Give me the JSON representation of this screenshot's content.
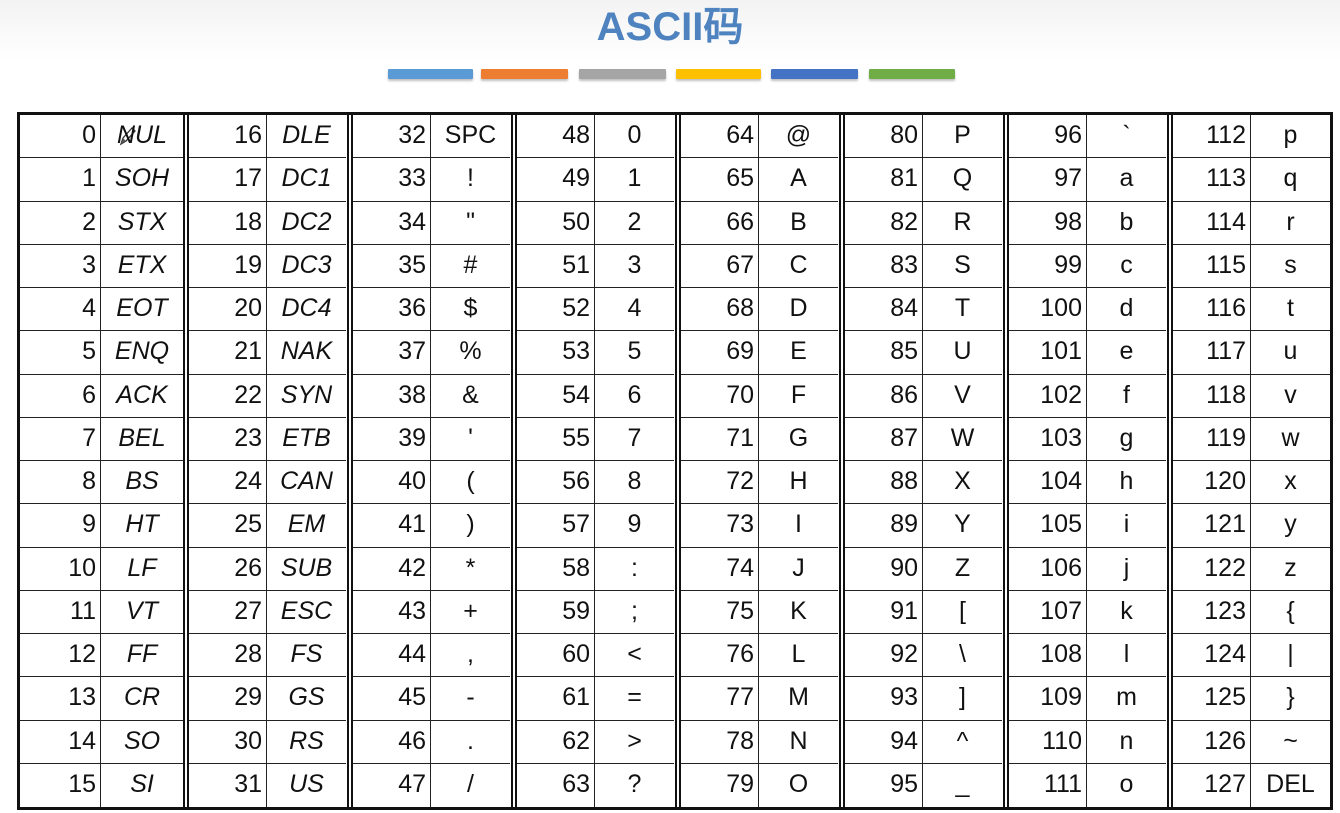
{
  "title": "ASCII码",
  "watermark": "",
  "accent_bars": [
    "#5b9bd5",
    "#ed7d31",
    "#a5a5a5",
    "#ffc000",
    "#4472c4",
    "#70ad47"
  ],
  "table": {
    "groups": [
      {
        "rows": [
          [
            "0",
            "NUL"
          ],
          [
            "1",
            "SOH"
          ],
          [
            "2",
            "STX"
          ],
          [
            "3",
            "ETX"
          ],
          [
            "4",
            "EOT"
          ],
          [
            "5",
            "ENQ"
          ],
          [
            "6",
            "ACK"
          ],
          [
            "7",
            "BEL"
          ],
          [
            "8",
            "BS"
          ],
          [
            "9",
            "HT"
          ],
          [
            "10",
            "LF"
          ],
          [
            "11",
            "VT"
          ],
          [
            "12",
            "FF"
          ],
          [
            "13",
            "CR"
          ],
          [
            "14",
            "SO"
          ],
          [
            "15",
            "SI"
          ]
        ],
        "italic": true
      },
      {
        "rows": [
          [
            "16",
            "DLE"
          ],
          [
            "17",
            "DC1"
          ],
          [
            "18",
            "DC2"
          ],
          [
            "19",
            "DC3"
          ],
          [
            "20",
            "DC4"
          ],
          [
            "21",
            "NAK"
          ],
          [
            "22",
            "SYN"
          ],
          [
            "23",
            "ETB"
          ],
          [
            "24",
            "CAN"
          ],
          [
            "25",
            "EM"
          ],
          [
            "26",
            "SUB"
          ],
          [
            "27",
            "ESC"
          ],
          [
            "28",
            "FS"
          ],
          [
            "29",
            "GS"
          ],
          [
            "30",
            "RS"
          ],
          [
            "31",
            "US"
          ]
        ],
        "italic": true
      },
      {
        "rows": [
          [
            "32",
            "SPC"
          ],
          [
            "33",
            "!"
          ],
          [
            "34",
            "\""
          ],
          [
            "35",
            "#"
          ],
          [
            "36",
            "$"
          ],
          [
            "37",
            "%"
          ],
          [
            "38",
            "&"
          ],
          [
            "39",
            "'"
          ],
          [
            "40",
            "("
          ],
          [
            "41",
            ")"
          ],
          [
            "42",
            "*"
          ],
          [
            "43",
            "+"
          ],
          [
            "44",
            ","
          ],
          [
            "45",
            "-"
          ],
          [
            "46",
            "."
          ],
          [
            "47",
            "/"
          ]
        ],
        "italic": false
      },
      {
        "rows": [
          [
            "48",
            "0"
          ],
          [
            "49",
            "1"
          ],
          [
            "50",
            "2"
          ],
          [
            "51",
            "3"
          ],
          [
            "52",
            "4"
          ],
          [
            "53",
            "5"
          ],
          [
            "54",
            "6"
          ],
          [
            "55",
            "7"
          ],
          [
            "56",
            "8"
          ],
          [
            "57",
            "9"
          ],
          [
            "58",
            ":"
          ],
          [
            "59",
            ";"
          ],
          [
            "60",
            "<"
          ],
          [
            "61",
            "="
          ],
          [
            "62",
            ">"
          ],
          [
            "63",
            "?"
          ]
        ],
        "italic": false
      },
      {
        "rows": [
          [
            "64",
            "@"
          ],
          [
            "65",
            "A"
          ],
          [
            "66",
            "B"
          ],
          [
            "67",
            "C"
          ],
          [
            "68",
            "D"
          ],
          [
            "69",
            "E"
          ],
          [
            "70",
            "F"
          ],
          [
            "71",
            "G"
          ],
          [
            "72",
            "H"
          ],
          [
            "73",
            "I"
          ],
          [
            "74",
            "J"
          ],
          [
            "75",
            "K"
          ],
          [
            "76",
            "L"
          ],
          [
            "77",
            "M"
          ],
          [
            "78",
            "N"
          ],
          [
            "79",
            "O"
          ]
        ],
        "italic": false
      },
      {
        "rows": [
          [
            "80",
            "P"
          ],
          [
            "81",
            "Q"
          ],
          [
            "82",
            "R"
          ],
          [
            "83",
            "S"
          ],
          [
            "84",
            "T"
          ],
          [
            "85",
            "U"
          ],
          [
            "86",
            "V"
          ],
          [
            "87",
            "W"
          ],
          [
            "88",
            "X"
          ],
          [
            "89",
            "Y"
          ],
          [
            "90",
            "Z"
          ],
          [
            "91",
            "["
          ],
          [
            "92",
            "\\"
          ],
          [
            "93",
            "]"
          ],
          [
            "94",
            "^"
          ],
          [
            "95",
            "_"
          ]
        ],
        "italic": false
      },
      {
        "rows": [
          [
            "96",
            "`"
          ],
          [
            "97",
            "a"
          ],
          [
            "98",
            "b"
          ],
          [
            "99",
            "c"
          ],
          [
            "100",
            "d"
          ],
          [
            "101",
            "e"
          ],
          [
            "102",
            "f"
          ],
          [
            "103",
            "g"
          ],
          [
            "104",
            "h"
          ],
          [
            "105",
            "i"
          ],
          [
            "106",
            "j"
          ],
          [
            "107",
            "k"
          ],
          [
            "108",
            "l"
          ],
          [
            "109",
            "m"
          ],
          [
            "110",
            "n"
          ],
          [
            "111",
            "o"
          ]
        ],
        "italic": false
      },
      {
        "rows": [
          [
            "112",
            "p"
          ],
          [
            "113",
            "q"
          ],
          [
            "114",
            "r"
          ],
          [
            "115",
            "s"
          ],
          [
            "116",
            "t"
          ],
          [
            "117",
            "u"
          ],
          [
            "118",
            "v"
          ],
          [
            "119",
            "w"
          ],
          [
            "120",
            "x"
          ],
          [
            "121",
            "y"
          ],
          [
            "122",
            "z"
          ],
          [
            "123",
            "{"
          ],
          [
            "124",
            "|"
          ],
          [
            "125",
            "}"
          ],
          [
            "126",
            "~"
          ],
          [
            "127",
            "DEL"
          ]
        ],
        "italic": false
      }
    ]
  }
}
